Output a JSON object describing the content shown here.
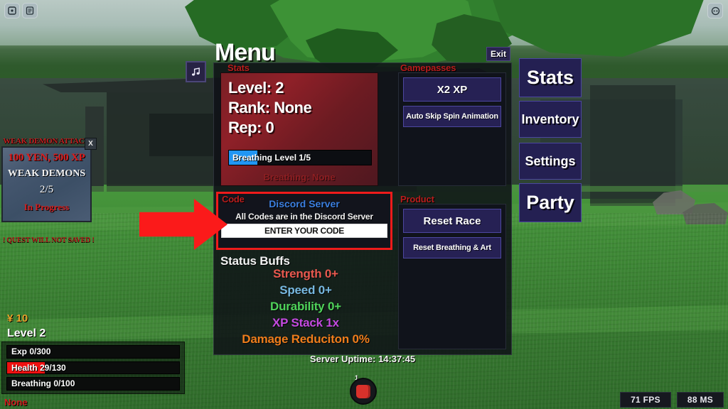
{
  "window": {
    "topbar_icons": [
      "roblox-home-icon",
      "roblox-chat-icon"
    ],
    "topright_icon": "roblox-settings-icon"
  },
  "hud": {
    "music_button_icon": "music-note-icon",
    "quest": {
      "title": "WEAK DEMON ATTACK",
      "reward": "100 YEN, 500 XP",
      "target": "WEAK DEMONS",
      "progress": "2/5",
      "status": "In Progress",
      "close_label": "X",
      "warning": "! QUEST WILL NOT SAVED !"
    },
    "currency": "¥ 10",
    "level": "Level 2",
    "bars": [
      {
        "label": "Exp 0/300",
        "percent": 0,
        "color": "#ffffff"
      },
      {
        "label": "Health 29/130",
        "percent": 22,
        "color": "#ee1111"
      },
      {
        "label": "Breathing 0/100",
        "percent": 0,
        "color": "#2196f3"
      }
    ],
    "equipped": "None",
    "hotbar": {
      "slot_number": "1",
      "item_icon": "fist-icon"
    },
    "performance": {
      "fps": "71 FPS",
      "ms": "88 MS"
    }
  },
  "menu": {
    "title": "Menu",
    "exit_label": "Exit",
    "stats": {
      "label": "Stats",
      "lines": [
        "Level: 2",
        "Rank: None",
        "Rep: 0"
      ],
      "breathing_bar": {
        "label": "Breathing Level 1/5",
        "percent": 20,
        "color": "#2196f3"
      },
      "breathing_type": "Breathing: None"
    },
    "code": {
      "label": "Code",
      "discord_link": "Discord Server",
      "hint": "All Codes are in the Discord Server",
      "input_placeholder": "ENTER YOUR CODE",
      "input_value": "",
      "highlight_color": "#ef1b1b"
    },
    "status_buffs": {
      "label": "Status Buffs",
      "items": [
        {
          "text": "Strength 0+",
          "color": "#e8594f"
        },
        {
          "text": "Speed 0+",
          "color": "#77b8e0"
        },
        {
          "text": "Durability 0+",
          "color": "#4fd35a"
        },
        {
          "text": "XP Stack 1x",
          "color": "#c44ae0"
        },
        {
          "text": "Damage Reduciton 0%",
          "color": "#ef7d1c"
        }
      ]
    },
    "gamepasses": {
      "label": "Gamepasses",
      "items": [
        "X2 XP",
        "Auto Skip Spin Animation"
      ]
    },
    "product": {
      "label": "Product",
      "items": [
        "Reset Race",
        "Reset Breathing & Art"
      ]
    },
    "server_uptime": "Server Uptime: 14:37:45"
  },
  "nav": {
    "items": [
      "Stats",
      "Inventory",
      "Settings",
      "Party"
    ]
  },
  "annotation": {
    "arrow_color": "#fb1a1a",
    "points_to": "code-section"
  }
}
